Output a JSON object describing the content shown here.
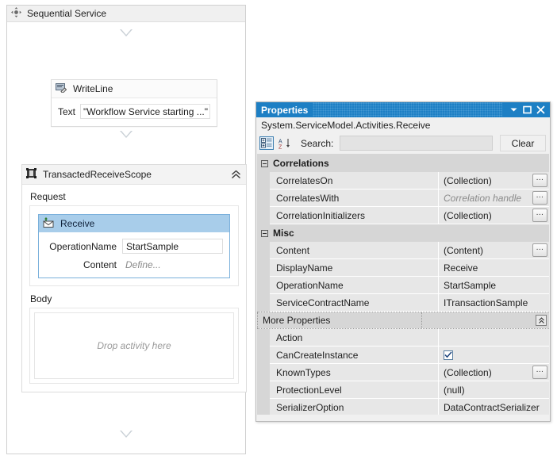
{
  "designer": {
    "root": {
      "title": "Sequential Service",
      "icon": "move-four-arrows-icon"
    },
    "writeline": {
      "title": "WriteLine",
      "icon": "writeline-icon",
      "text_label": "Text",
      "text_value": "\"Workflow Service starting ...\""
    },
    "scope": {
      "title": "TransactedReceiveScope",
      "icon": "transacted-scope-icon",
      "collapse_icon": "chevron-up-double-icon",
      "request_label": "Request",
      "body_label": "Body",
      "drop_hint": "Drop activity here",
      "receive": {
        "title": "Receive",
        "icon": "receive-envelope-icon",
        "rows": [
          {
            "key": "OperationName",
            "value": "StartSample",
            "kind": "input"
          },
          {
            "key": "Content",
            "value": "Define...",
            "kind": "ghost"
          }
        ]
      }
    }
  },
  "properties": {
    "window_title": "Properties",
    "titlebar_buttons": [
      "dropdown-caret-icon",
      "maximize-icon",
      "close-icon"
    ],
    "subtitle": "System.ServiceModel.Activities.Receive",
    "toolbar": {
      "categorized_icon": "categorized-view-icon",
      "alphabetical_icon": "alphabetical-sort-icon",
      "search_label": "Search:",
      "search_value": "",
      "search_placeholder": "",
      "clear_label": "Clear"
    },
    "categories": [
      {
        "name": "Correlations",
        "expanded": true,
        "rows": [
          {
            "name": "CorrelatesOn",
            "value": "(Collection)",
            "ellipsis": true,
            "italic": false
          },
          {
            "name": "CorrelatesWith",
            "value": "Correlation handle",
            "ellipsis": true,
            "italic": true
          },
          {
            "name": "CorrelationInitializers",
            "value": "(Collection)",
            "ellipsis": true,
            "italic": false
          }
        ]
      },
      {
        "name": "Misc",
        "expanded": true,
        "rows": [
          {
            "name": "Content",
            "value": "(Content)",
            "ellipsis": true,
            "italic": false
          },
          {
            "name": "DisplayName",
            "value": "Receive",
            "ellipsis": false,
            "italic": false
          },
          {
            "name": "OperationName",
            "value": "StartSample",
            "ellipsis": false,
            "italic": false
          },
          {
            "name": "ServiceContractName",
            "value": "ITransactionSample",
            "ellipsis": false,
            "italic": false
          }
        ]
      }
    ],
    "more_properties": {
      "label": "More Properties",
      "collapse_icon": "collapse-pin-icon",
      "rows": [
        {
          "name": "Action",
          "value": "",
          "ellipsis": false,
          "italic": false
        },
        {
          "name": "CanCreateInstance",
          "value": "",
          "checkbox": true,
          "checked": true,
          "ellipsis": false
        },
        {
          "name": "KnownTypes",
          "value": "(Collection)",
          "ellipsis": true,
          "italic": false
        },
        {
          "name": "ProtectionLevel",
          "value": "(null)",
          "ellipsis": false,
          "italic": false
        },
        {
          "name": "SerializerOption",
          "value": "DataContractSerializer",
          "ellipsis": false,
          "italic": false
        }
      ]
    }
  },
  "colors": {
    "titlebar_blue": "#1d7fc4",
    "selected_activity_blue": "#a8cdea",
    "category_gray": "#d6d6d6",
    "row_gray": "#e7e7e7"
  }
}
